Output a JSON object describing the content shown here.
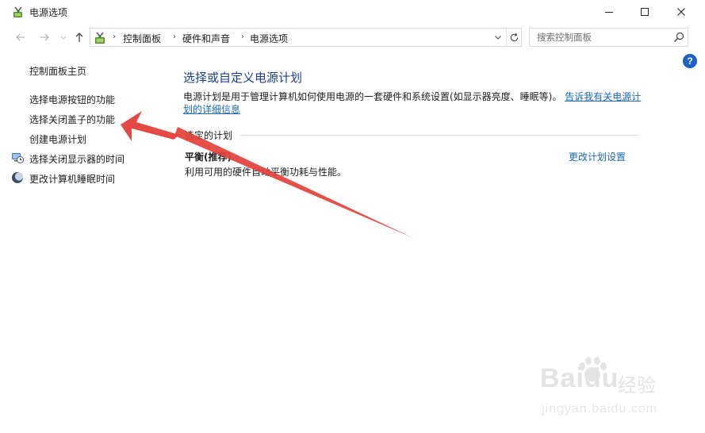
{
  "window": {
    "title": "电源选项"
  },
  "address_bar": {
    "crumbs": [
      "控制面板",
      "硬件和声音",
      "电源选项"
    ]
  },
  "search": {
    "placeholder": "搜索控制面板"
  },
  "help": {
    "glyph": "?"
  },
  "sidebar": {
    "home": "控制面板主页",
    "items": [
      "选择电源按钮的功能",
      "选择关闭盖子的功能",
      "创建电源计划",
      "选择关闭显示器的时间",
      "更改计算机睡眠时间"
    ]
  },
  "main": {
    "heading": "选择或自定义电源计划",
    "description_text": "电源计划是用于管理计算机如何使用电源的一套硬件和系统设置(如显示器亮度、睡眠等)。",
    "description_link": "告诉我有关电源计划的详细信息",
    "section_label": "选定的计划",
    "plan_name": "平衡(推荐)",
    "plan_description": "利用可用的硬件自动平衡功耗与性能。",
    "change_plan_link": "更改计划设置"
  },
  "watermark": {
    "logo": "Baidu",
    "logo_suffix": "经验",
    "url": "jingyan.baidu.com"
  },
  "colors": {
    "link": "#1a66b3",
    "heading": "#1a3e8c",
    "arrow": "#e2403a",
    "help": "#1c62c5"
  }
}
